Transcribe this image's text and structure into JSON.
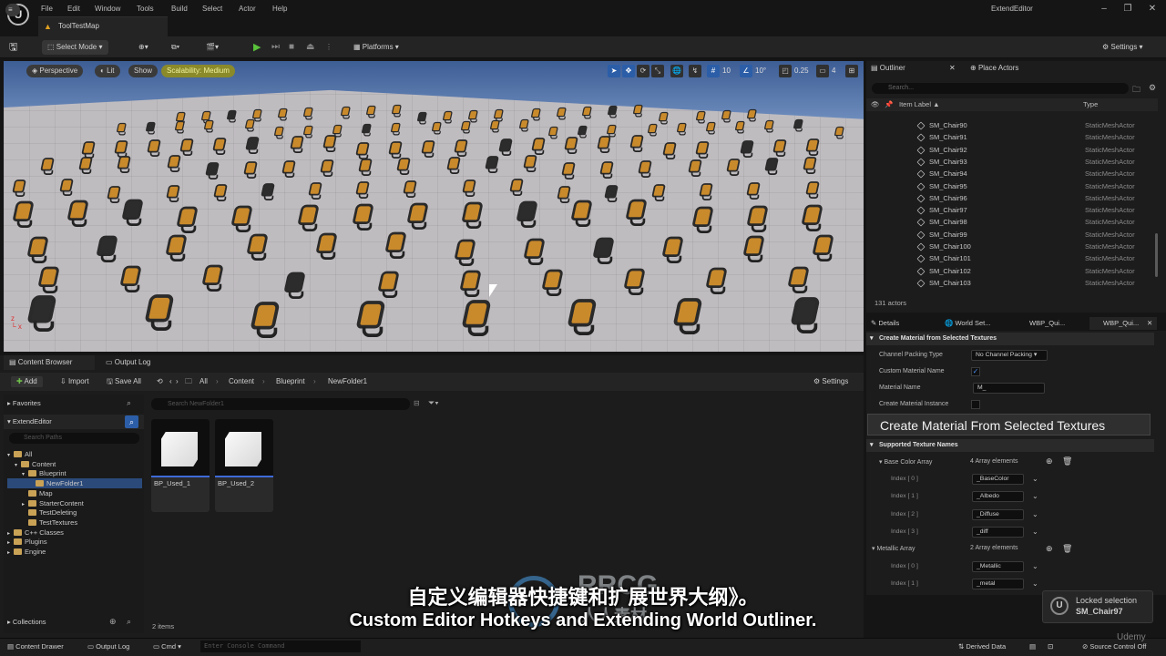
{
  "menu": {
    "items": [
      "File",
      "Edit",
      "Window",
      "Tools",
      "Build",
      "Select",
      "Actor",
      "Help"
    ]
  },
  "doc_tab": "ToolTestMap",
  "app_title": "ExtendEditor",
  "toolbar": {
    "select_mode": "Select Mode",
    "platforms": "Platforms",
    "settings": "Settings"
  },
  "viewport": {
    "perspective": "Perspective",
    "lit": "Lit",
    "show": "Show",
    "scalability": "Scalability: Medium",
    "grid_snap": "10",
    "rot_snap": "10°",
    "scale_snap": "0.25",
    "camera_speed": "4"
  },
  "outliner": {
    "tab": "Outliner",
    "place_actors": "Place Actors",
    "search_placeholder": "Search...",
    "col_label": "Item Label ▲",
    "col_type": "Type",
    "rows": [
      {
        "name": "SM_Chair90",
        "type": "StaticMeshActor"
      },
      {
        "name": "SM_Chair91",
        "type": "StaticMeshActor"
      },
      {
        "name": "SM_Chair92",
        "type": "StaticMeshActor"
      },
      {
        "name": "SM_Chair93",
        "type": "StaticMeshActor"
      },
      {
        "name": "SM_Chair94",
        "type": "StaticMeshActor"
      },
      {
        "name": "SM_Chair95",
        "type": "StaticMeshActor"
      },
      {
        "name": "SM_Chair96",
        "type": "StaticMeshActor"
      },
      {
        "name": "SM_Chair97",
        "type": "StaticMeshActor"
      },
      {
        "name": "SM_Chair98",
        "type": "StaticMeshActor"
      },
      {
        "name": "SM_Chair99",
        "type": "StaticMeshActor"
      },
      {
        "name": "SM_Chair100",
        "type": "StaticMeshActor"
      },
      {
        "name": "SM_Chair101",
        "type": "StaticMeshActor"
      },
      {
        "name": "SM_Chair102",
        "type": "StaticMeshActor"
      },
      {
        "name": "SM_Chair103",
        "type": "StaticMeshActor"
      }
    ],
    "count": "131 actors"
  },
  "details": {
    "tabs": [
      "Details",
      "World Set...",
      "WBP_Qui...",
      "WBP_Qui..."
    ],
    "section1": "Create Material from Selected Textures",
    "channel_packing_label": "Channel Packing Type",
    "channel_packing_value": "No Channel Packing",
    "custom_material_name_label": "Custom Material Name",
    "material_name_label": "Material Name",
    "material_name_value": "M_",
    "create_instance_label": "Create Material Instance",
    "big_button": "Create Material From Selected Textures",
    "section2": "Supported Texture Names",
    "base_color_label": "Base Color Array",
    "base_color_count": "4 Array elements",
    "base_color_items": [
      {
        "idx": "Index [ 0 ]",
        "val": "_BaseColor"
      },
      {
        "idx": "Index [ 1 ]",
        "val": "_Albedo"
      },
      {
        "idx": "Index [ 2 ]",
        "val": "_Diffuse"
      },
      {
        "idx": "Index [ 3 ]",
        "val": "_diff"
      }
    ],
    "metallic_label": "Metallic Array",
    "metallic_count": "2 Array elements",
    "metallic_items": [
      {
        "idx": "Index [ 0 ]",
        "val": "_Metallic"
      },
      {
        "idx": "Index [ 1 ]",
        "val": "_metal"
      }
    ]
  },
  "content_browser": {
    "tab": "Content Browser",
    "output_log_tab": "Output Log",
    "add": "Add",
    "import": "Import",
    "save_all": "Save All",
    "breadcrumb": [
      "All",
      "Content",
      "Blueprint",
      "NewFolder1"
    ],
    "settings": "Settings",
    "favorites": "Favorites",
    "project": "ExtendEditor",
    "search_paths": "Search Paths",
    "search_assets": "Search NewFolder1",
    "tree": [
      "All",
      "Content",
      "Blueprint",
      "NewFolder1",
      "Map",
      "StarterContent",
      "TestDeleting",
      "TestTextures",
      "C++ Classes",
      "Plugins",
      "Engine"
    ],
    "assets": [
      "BP_Used_1",
      "BP_Used_2"
    ],
    "items_count": "2 items",
    "collections": "Collections"
  },
  "statusbar": {
    "content_drawer": "Content Drawer",
    "output_log": "Output Log",
    "cmd": "Cmd",
    "console_placeholder": "Enter Console Command",
    "derived_data": "Derived Data",
    "source_control": "Source Control Off"
  },
  "toast": {
    "line1": "Locked selection",
    "line2": "SM_Chair97"
  },
  "subtitles": {
    "zh": "自定义编辑器快捷键和扩展世界大纲》。",
    "en": "Custom Editor Hotkeys and Extending World Outliner."
  },
  "watermark": {
    "text": "RRCG",
    "sub": "人人素材",
    "udemy": "Udemy"
  },
  "colors": {
    "accent": "#2c5ea8",
    "scalability": "#8a8a2a",
    "folder": "#c9a256",
    "chair": "#c98a2c"
  }
}
